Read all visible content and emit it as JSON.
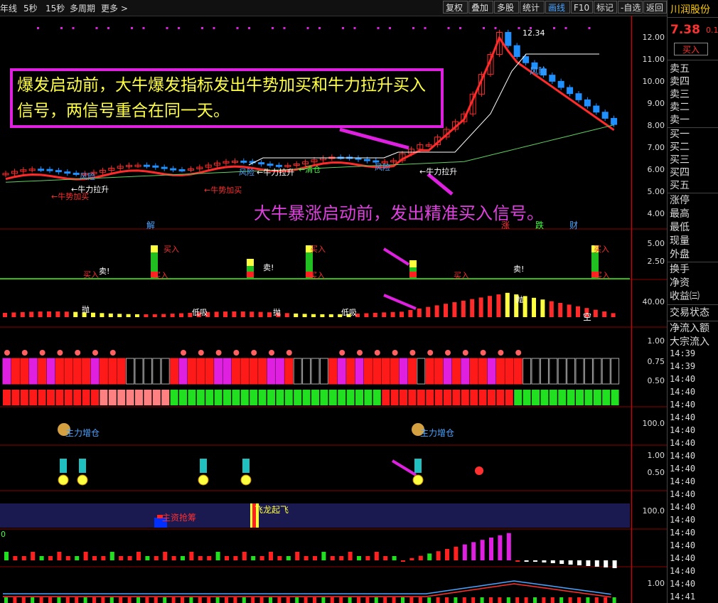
{
  "toolbar": {
    "left_items": [
      "年线",
      "5秒",
      "15秒",
      "多周期",
      "更多 >"
    ],
    "buttons": [
      "复权",
      "叠加",
      "多股",
      "统计",
      "画线",
      "F10",
      "标记",
      "-自选",
      "返回"
    ],
    "active_button": "画线"
  },
  "quote": {
    "stock_name": "川润股份",
    "price": "7.38",
    "change_pct": "0.1",
    "buy_button": "买入",
    "order_book": [
      "卖五",
      "卖四",
      "卖三",
      "卖二",
      "卖一",
      "买一",
      "买二",
      "买三",
      "买四",
      "买五"
    ],
    "stats": [
      "涨停",
      "最高",
      "最低",
      "现量",
      "外盘",
      "换手",
      "净资",
      "收益㈢",
      "交易状态",
      "净流入额",
      "大宗流入"
    ],
    "times": [
      "14:39",
      "14:39",
      "14:40",
      "14:40",
      "14:40",
      "14:40",
      "14:40",
      "14:40",
      "14:40",
      "14:40",
      "14:40",
      "14:40",
      "14:40",
      "14:40",
      "14:40",
      "14:40",
      "14:40",
      "14:40",
      "14:40",
      "14:41"
    ]
  },
  "annotations": {
    "note_main": "爆发启动前，大牛爆发指标发出牛势加买和牛力拉升买入信号，两信号重合在同一天。",
    "note_secondary": "大牛暴涨启动前，发出精准买入信号。",
    "peak_label": "12.34",
    "risk_label": "风险",
    "signal_pull": "←牛力拉升",
    "signal_buy": "←牛势加买",
    "signal_clear": "←清仓",
    "signal_risk": "风险",
    "buy_marker": "买入",
    "sell_marker": "卖!",
    "throw_marker": "抛",
    "low_suck": "低吸",
    "empty_marker": "空",
    "jie": "解",
    "zhang": "涨",
    "die": "跌",
    "cai": "财",
    "big_hold": "主力增仓",
    "main_chip": "主资抢筹",
    "dragon": "飞龙起飞",
    "zero": "0"
  },
  "scales": {
    "price_ticks": [
      "12.00",
      "11.00",
      "10.00",
      "9.00",
      "8.00",
      "7.00",
      "6.00",
      "5.00",
      "4.00"
    ],
    "p2_ticks": [
      "5.00",
      "2.50"
    ],
    "p3_ticks": [
      "40.00"
    ],
    "p4_ticks": [
      "1.00",
      "0.75",
      "0.50"
    ],
    "p5_ticks": [
      "100.0"
    ],
    "p6_ticks": [
      "1.00",
      "0.50"
    ],
    "p7_ticks": [
      "100.0"
    ],
    "p9_ticks": [
      "1.00"
    ]
  },
  "colors": {
    "up": "#ff2a2a",
    "down": "#1e90ff",
    "magenta": "#e020e0",
    "yellow": "#ffff40",
    "green": "#20e020",
    "accent": "#4aa3ff"
  }
}
